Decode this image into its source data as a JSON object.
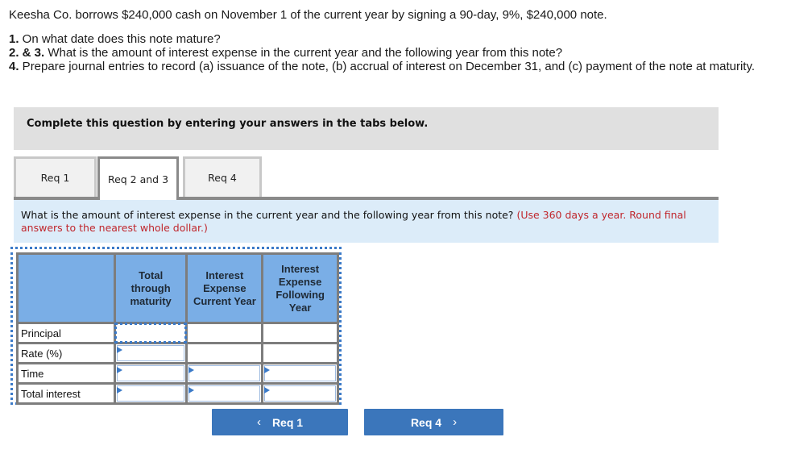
{
  "problem": {
    "intro": "Keesha Co. borrows $240,000 cash on November 1 of the current year by signing a 90-day, 9%, $240,000 note.",
    "items": [
      {
        "num": "1.",
        "text": " On what date does this note mature?"
      },
      {
        "num": "2. & 3.",
        "text": " What is the amount of interest expense in the current year and the following year from this note?"
      },
      {
        "num": "4.",
        "text": " Prepare journal entries to record (a) issuance of the note, (b) accrual of interest on December 31, and (c) payment of the note at maturity."
      }
    ]
  },
  "instructions": "Complete this question by entering your answers in the tabs below.",
  "tabs": [
    {
      "label": "Req 1",
      "active": false
    },
    {
      "label": "Req 2 and 3",
      "active": true
    },
    {
      "label": "Req 4",
      "active": false
    }
  ],
  "question": {
    "text": "What is the amount of interest expense in the current year and the following year from this note?",
    "note": "(Use 360 days a year. Round final answers to the nearest whole dollar.)"
  },
  "grid": {
    "headers": [
      "",
      "Total through maturity",
      "Interest Expense Current Year",
      "Interest Expense Following Year"
    ],
    "rows": [
      {
        "label": "Principal",
        "values": [
          "",
          "",
          ""
        ]
      },
      {
        "label": "Rate (%)",
        "values": [
          "",
          "",
          ""
        ]
      },
      {
        "label": "Time",
        "values": [
          "",
          "",
          ""
        ]
      },
      {
        "label": "Total interest",
        "values": [
          "",
          "",
          ""
        ]
      }
    ]
  },
  "navigation": {
    "prev": {
      "label": "Req 1",
      "icon": "chevron-left-icon",
      "glyph": "‹"
    },
    "next": {
      "label": "Req 4",
      "icon": "chevron-right-icon",
      "glyph": "›"
    }
  },
  "colors": {
    "header_blue": "#7aaee6",
    "button_blue": "#3b76bb",
    "note_red": "#c0272d",
    "question_bg": "#dcecf9",
    "instructions_bg": "#e0e0e0"
  }
}
